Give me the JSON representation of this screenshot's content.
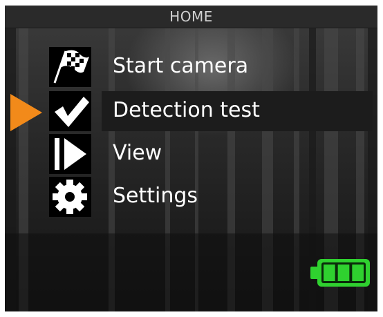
{
  "header": {
    "title": "HOME"
  },
  "menu": {
    "selected_index": 1,
    "items": [
      {
        "label": "Start camera",
        "icon": "checkered-flag-icon"
      },
      {
        "label": "Detection test",
        "icon": "checkmark-icon"
      },
      {
        "label": "View",
        "icon": "play-icon"
      },
      {
        "label": "Settings",
        "icon": "gear-icon"
      }
    ]
  },
  "status": {
    "battery_level": 1.0,
    "battery_bars": 3
  },
  "colors": {
    "accent": "#f28a1a",
    "battery": "#2fd12f",
    "text": "#ffffff"
  }
}
